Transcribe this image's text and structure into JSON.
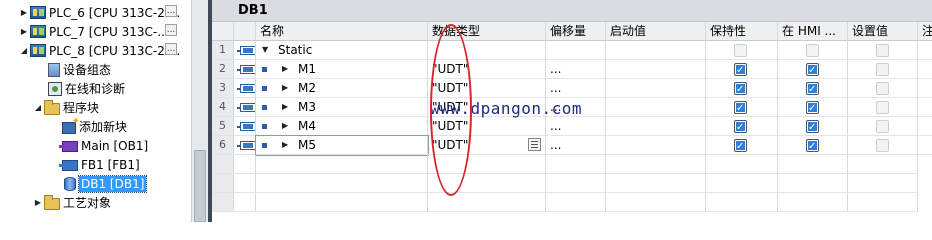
{
  "tree": {
    "items": [
      {
        "label": "PLC_6 [CPU 313C-2 ...",
        "arrow": "▶",
        "icon": "plc-icon"
      },
      {
        "label": "PLC_7 [CPU 313C-...",
        "arrow": "▶",
        "icon": "plc-icon"
      },
      {
        "label": "PLC_8 [CPU 313C-2 ...",
        "arrow": "◢",
        "icon": "plc-icon"
      },
      {
        "label": "设备组态",
        "icon": "device-config-icon"
      },
      {
        "label": "在线和诊断",
        "icon": "online-diagnostics-icon"
      },
      {
        "label": "程序块",
        "arrow": "◢",
        "icon": "folder-icon"
      },
      {
        "label": "添加新块",
        "icon": "add-new-block-icon"
      },
      {
        "label": "Main [OB1]",
        "icon": "ob-icon"
      },
      {
        "label": "FB1 [FB1]",
        "icon": "fb-icon"
      },
      {
        "label": "DB1 [DB1]",
        "icon": "db-icon"
      },
      {
        "label": "工艺对象",
        "arrow": "▶",
        "icon": "folder-icon"
      }
    ],
    "expand_button": "..."
  },
  "editor": {
    "title": "DB1",
    "columns": [
      "名称",
      "数据类型",
      "偏移量",
      "启动值",
      "保持性",
      "在 HMI ...",
      "设置值",
      "注"
    ],
    "rows": [
      {
        "num": "1",
        "name": "Static",
        "type": "",
        "offset": "",
        "start": "",
        "retain": false,
        "hmi": false,
        "setpoint": false,
        "disabled": true
      },
      {
        "num": "2",
        "name": "M1",
        "type": "\"UDT\"",
        "offset": "...",
        "start": "",
        "retain": true,
        "hmi": true,
        "setpoint": false
      },
      {
        "num": "3",
        "name": "M2",
        "type": "\"UDT\"",
        "offset": "...",
        "start": "",
        "retain": true,
        "hmi": true,
        "setpoint": false
      },
      {
        "num": "4",
        "name": "M3",
        "type": "\"UDT\"",
        "offset": "...",
        "start": "",
        "retain": true,
        "hmi": true,
        "setpoint": false
      },
      {
        "num": "5",
        "name": "M4",
        "type": "\"UDT\"",
        "offset": "...",
        "start": "",
        "retain": true,
        "hmi": true,
        "setpoint": false
      },
      {
        "num": "6",
        "name": "M5",
        "type": "\"UDT\"",
        "offset": "...",
        "start": "",
        "retain": true,
        "hmi": true,
        "setpoint": false
      }
    ]
  },
  "watermark": "www.dpangon.com",
  "colors": {
    "annotation": "#d6262a",
    "selection": "#3399ff",
    "check": "#2f7fd9"
  }
}
